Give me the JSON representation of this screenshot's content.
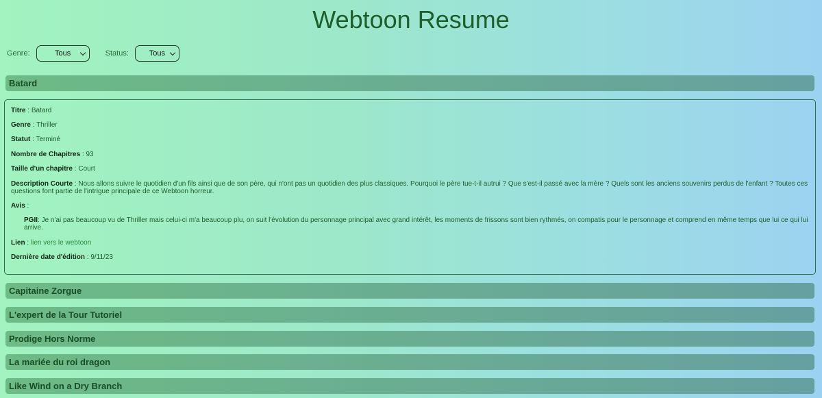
{
  "page": {
    "title": "Webtoon Resume"
  },
  "filters": {
    "genre_label": "Genre:",
    "genre_value": "Tous",
    "status_label": "Status:",
    "status_value": "Tous"
  },
  "open_entry": {
    "header": "Batard",
    "fields": {
      "titre_label": "Titre",
      "titre": "Batard",
      "genre_label": "Genre",
      "genre": "Thriller",
      "statut_label": "Statut",
      "statut": "Terminé",
      "chapitres_label": "Nombre de Chapitres",
      "chapitres": "93",
      "taille_label": "Taille d'un chapitre",
      "taille": "Court",
      "description_label": "Description Courte",
      "description": "Nous allons suivre le quotidien d'un fils ainsi que de son père, qui n'ont pas un quotidien des plus classiques. Pourquoi le père tue-t-il autrui ? Que s'est-il passé avec la mère ? Quels sont les anciens souvenirs perdus de l'enfant ? Toutes ces questions font partie de l'intrigue principale de ce Webtoon horreur.",
      "avis_label": "Avis",
      "avis_author": "PGII",
      "avis_text": "Je n'ai pas beaucoup vu de Thriller mais celui-ci m'a beaucoup plu, on suit l'évolution du personnage principal avec grand intérêt, les moments de frissons sont bien rythmés, on compatis pour le personnage et comprend en même temps que lui ce qui lui arrive.",
      "lien_label": "Lien",
      "lien": "lien vers le webtoon",
      "date_label": "Dernière date d'édition",
      "date": "9/11/23"
    }
  },
  "entries": [
    "Capitaine Zorgue",
    "L'expert de la Tour Tutoriel",
    "Prodige Hors Norme",
    "La mariée du roi dragon",
    "Like Wind on a Dry Branch"
  ]
}
